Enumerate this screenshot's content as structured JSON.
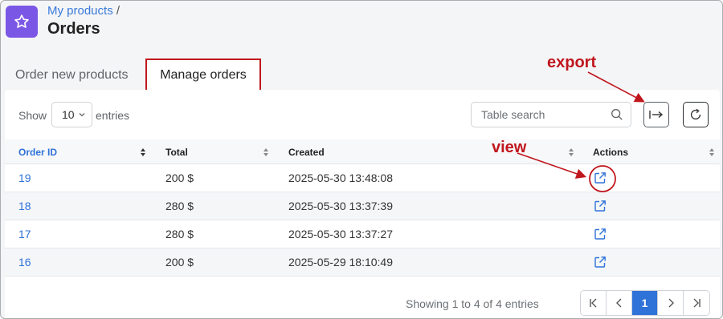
{
  "header": {
    "breadcrumb_link": "My products",
    "breadcrumb_sep": "/",
    "title": "Orders",
    "logo_icon": "star-icon",
    "accent": "#7b57e6"
  },
  "tabs": [
    {
      "label": "Order new products",
      "active": false
    },
    {
      "label": "Manage orders",
      "active": true
    }
  ],
  "toolbar": {
    "show_label": "Show",
    "entries_value": "10",
    "entries_label": "entries",
    "search_placeholder": "Table search",
    "export_icon": "export-icon",
    "refresh_icon": "refresh-icon"
  },
  "table": {
    "columns": [
      "Order ID",
      "Total",
      "Created",
      "Actions"
    ],
    "rows": [
      {
        "id": "19",
        "total": "200 $",
        "created": "2025-05-30 13:48:08"
      },
      {
        "id": "18",
        "total": "280 $",
        "created": "2025-05-30 13:37:39"
      },
      {
        "id": "17",
        "total": "280 $",
        "created": "2025-05-30 13:37:27"
      },
      {
        "id": "16",
        "total": "200 $",
        "created": "2025-05-29 18:10:49"
      }
    ]
  },
  "footer": {
    "showing_text": "Showing 1 to 4 of 4 entries",
    "current_page": "1"
  },
  "annotations": {
    "export": "export",
    "view": "view",
    "color": "#c0171d"
  }
}
